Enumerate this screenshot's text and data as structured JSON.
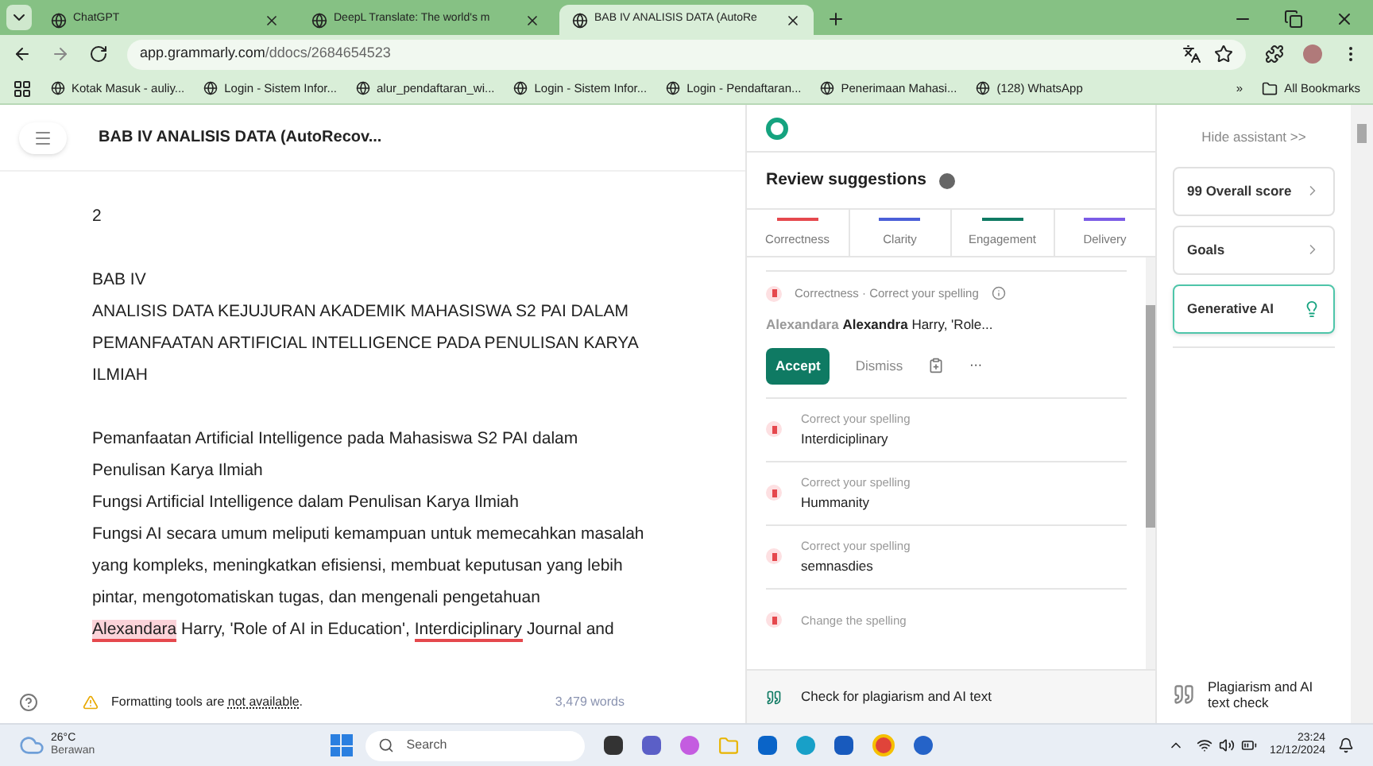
{
  "browser": {
    "tabs": [
      {
        "title": "ChatGPT",
        "selected": false
      },
      {
        "title": "DeepL Translate: The world's m",
        "selected": false
      },
      {
        "title": "BAB IV ANALISIS DATA (AutoRe",
        "selected": true
      }
    ],
    "url_host": "app.grammarly.com",
    "url_path": "/ddocs/2684654523",
    "bookmarks": [
      "Kotak Masuk - auliy...",
      "Login - Sistem Infor...",
      "alur_pendaftaran_wi...",
      "Login - Sistem Infor...",
      "Login - Pendaftaran...",
      "Penerimaan Mahasi...",
      "(128) WhatsApp"
    ],
    "more_bookmarks": "»",
    "all_bookmarks": "All Bookmarks"
  },
  "document": {
    "title": "BAB IV ANALISIS DATA (AutoRecov...",
    "lines": [
      {
        "kind": "text",
        "text": "2"
      },
      {
        "kind": "blank"
      },
      {
        "kind": "text",
        "text": "BAB IV"
      },
      {
        "kind": "text",
        "text": "ANALISIS DATA KEJUJURAN AKADEMIK MAHASISWA S2 PAI DALAM"
      },
      {
        "kind": "text",
        "text": "PEMANFAATAN ARTIFICIAL INTELLIGENCE PADA PENULISAN KARYA"
      },
      {
        "kind": "text",
        "text": "ILMIAH"
      },
      {
        "kind": "blank"
      },
      {
        "kind": "text",
        "text": "Pemanfaatan Artificial Intelligence pada Mahasiswa S2 PAI dalam"
      },
      {
        "kind": "text",
        "text": "Penulisan Karya Ilmiah"
      },
      {
        "kind": "text",
        "text": "Fungsi Artificial Intelligence dalam Penulisan Karya Ilmiah"
      },
      {
        "kind": "text",
        "text": "Fungsi AI secara umum meliputi kemampuan untuk memecahkan masalah"
      },
      {
        "kind": "text",
        "text": "yang kompleks, meningkatkan efisiensi, membuat keputusan yang lebih"
      },
      {
        "kind": "text",
        "text": "pintar, mengotomatiskan tugas, dan mengenali pengetahuan"
      },
      {
        "kind": "segments",
        "segments": [
          {
            "text": "Alexandara",
            "highlighted": true,
            "underlined": true
          },
          {
            "text": " Harry, 'Role of AI in Education', ",
            "highlighted": false,
            "underlined": false
          },
          {
            "text": "Interdiciplinary",
            "highlighted": false,
            "underlined": true
          },
          {
            "text": " Journal and",
            "highlighted": false,
            "underlined": false
          }
        ]
      }
    ],
    "footer_text": "Formatting tools are ",
    "footer_link": "not available",
    "footer_end": ".",
    "word_count": "3,479 words"
  },
  "assistant": {
    "heading": "Review suggestions",
    "categories": [
      {
        "label": "Correctness",
        "color": "#e5484d"
      },
      {
        "label": "Clarity",
        "color": "#4a5fd8"
      },
      {
        "label": "Engagement",
        "color": "#0f7a63"
      },
      {
        "label": "Delivery",
        "color": "#7b5ce6"
      }
    ],
    "active": {
      "category": "Correctness · Correct your spelling",
      "wrong": "Alexandara",
      "right": "Alexandra",
      "rest": " Harry, 'Role...",
      "accept": "Accept",
      "dismiss": "Dismiss",
      "more": "···"
    },
    "suggestions": [
      {
        "label": "Correct your spelling",
        "word": "Interdiciplinary"
      },
      {
        "label": "Correct your spelling",
        "word": "Hummanity"
      },
      {
        "label": "Correct your spelling",
        "word": "semnasdies"
      },
      {
        "label": "Change the spelling"
      }
    ],
    "plagiarism": "Check for plagiarism and AI text"
  },
  "side": {
    "hide": "Hide assistant >>",
    "cards": [
      {
        "label": "99 Overall score",
        "kind": "chevron",
        "selected": false
      },
      {
        "label": "Goals",
        "kind": "chevron",
        "selected": false
      },
      {
        "label": "Generative AI",
        "kind": "bulb",
        "selected": true
      }
    ],
    "plagiarism": "Plagiarism and AI text check"
  },
  "taskbar": {
    "temp": "26°C",
    "weather": "Berawan",
    "search": "Search",
    "time": "23:24",
    "date": "12/12/2024"
  }
}
